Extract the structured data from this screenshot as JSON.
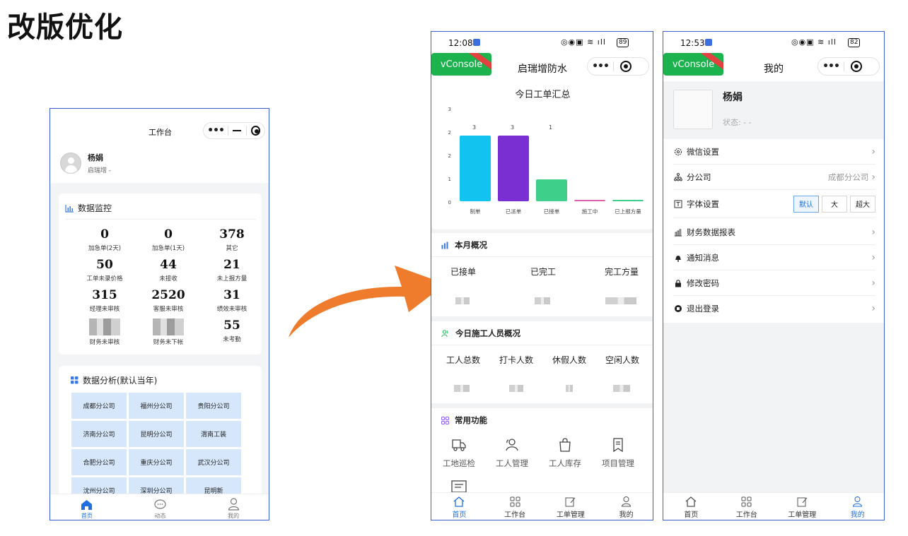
{
  "slide": {
    "title": "改版优化"
  },
  "old_app": {
    "navbar_title": "工作台",
    "user": {
      "name": "杨娟",
      "subtitle": "启瑞增 -"
    },
    "monitor": {
      "title": "数据监控",
      "stats": [
        {
          "value": "0",
          "label": "加急单(2天)"
        },
        {
          "value": "0",
          "label": "加急单(1天)"
        },
        {
          "value": "378",
          "label": "其它"
        },
        {
          "value": "50",
          "label": "工单未录价格"
        },
        {
          "value": "44",
          "label": "未接收"
        },
        {
          "value": "21",
          "label": "未上报方量"
        },
        {
          "value": "315",
          "label": "经理未审核"
        },
        {
          "value": "2520",
          "label": "客服未审核"
        },
        {
          "value": "31",
          "label": "绩效未审核"
        },
        {
          "value": "",
          "label": "财务未审核"
        },
        {
          "value": "",
          "label": "财务未下帐"
        },
        {
          "value": "55",
          "label": "未考勤"
        }
      ]
    },
    "analysis": {
      "title": "数据分析(默认当年)",
      "branches": [
        "成都分公司",
        "福州分公司",
        "贵阳分公司",
        "济南分公司",
        "昆明分公司",
        "渭南工装",
        "合肥分公司",
        "重庆分公司",
        "武汉分公司",
        "沈州分公司",
        "深圳分公司",
        "昆明新"
      ]
    },
    "tabs": [
      {
        "label": "首页",
        "icon": "home-icon"
      },
      {
        "label": "动态",
        "icon": "chat-icon"
      },
      {
        "label": "我的",
        "icon": "user-icon"
      }
    ],
    "accent": "#1f6fe0"
  },
  "home": {
    "time": "12:08",
    "battery": "89",
    "vconsole": "vConsole",
    "navbar_title": "启瑞增防水",
    "summary_title": "今日工单汇总",
    "chart_data": {
      "type": "bar",
      "title": "今日工单汇总",
      "categories": [
        "制单",
        "已派单",
        "已接单",
        "施工中",
        "已上报方量"
      ],
      "values": [
        3,
        3,
        1,
        0,
        0
      ],
      "colors": [
        "#12c3ef",
        "#7a2fd2",
        "#3ecf8a",
        "#e060b0",
        "#3ecf8a"
      ],
      "ylim": [
        0,
        3
      ],
      "yticks": [
        "0",
        "1",
        "2",
        "2",
        "3"
      ]
    },
    "month": {
      "title": "本月概况",
      "cols": [
        "已接单",
        "已完工",
        "完工方量"
      ]
    },
    "workers": {
      "title": "今日施工人员概况",
      "cols": [
        "工人总数",
        "打卡人数",
        "休假人数",
        "空闲人数"
      ]
    },
    "features": {
      "title": "常用功能",
      "items": [
        {
          "label": "工地巡检",
          "icon": "truck-icon"
        },
        {
          "label": "工人管理",
          "icon": "workers-icon"
        },
        {
          "label": "工人库存",
          "icon": "bag-icon"
        },
        {
          "label": "项目管理",
          "icon": "bookmark-icon"
        }
      ]
    },
    "tabs": [
      {
        "label": "首页",
        "icon": "home-icon"
      },
      {
        "label": "工作台",
        "icon": "grid-icon"
      },
      {
        "label": "工单管理",
        "icon": "edit-icon"
      },
      {
        "label": "我的",
        "icon": "user-icon"
      }
    ]
  },
  "mine": {
    "time": "12:53",
    "battery": "82",
    "vconsole": "vConsole",
    "navbar_title": "我的",
    "user": {
      "name": "杨娟",
      "status": "状态: - -"
    },
    "menu": [
      {
        "label": "微信设置",
        "icon": "gear-icon"
      },
      {
        "label": "分公司",
        "icon": "org-icon",
        "value": "成都分公司"
      },
      {
        "label": "字体设置",
        "icon": "font-icon"
      },
      {
        "label": "财务数据报表",
        "icon": "chart-icon"
      },
      {
        "label": "通知消息",
        "icon": "bell-icon"
      },
      {
        "label": "修改密码",
        "icon": "lock-icon"
      },
      {
        "label": "退出登录",
        "icon": "logout-icon"
      }
    ],
    "font_options": [
      "默认",
      "大",
      "超大"
    ],
    "tabs": [
      {
        "label": "首页",
        "icon": "home-icon"
      },
      {
        "label": "工作台",
        "icon": "grid-icon"
      },
      {
        "label": "工单管理",
        "icon": "edit-icon"
      },
      {
        "label": "我的",
        "icon": "user-icon"
      }
    ]
  },
  "arrow_color": "#ef7b2c"
}
